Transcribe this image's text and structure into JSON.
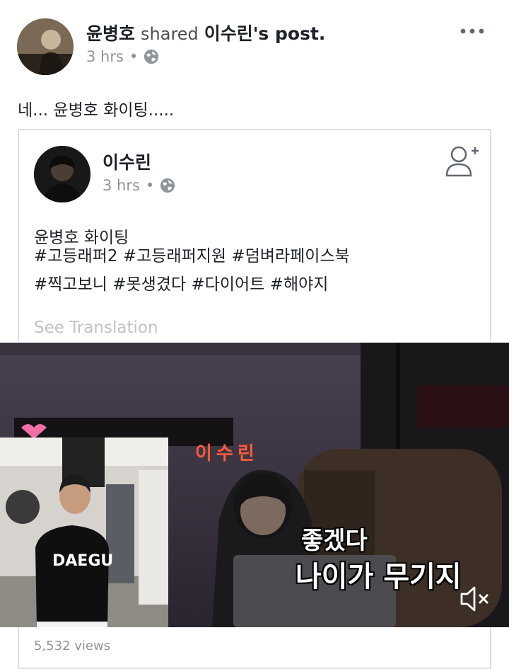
{
  "post": {
    "sharer_name": "윤병호",
    "shared_text": "shared",
    "original_owner": "이수린's post.",
    "time": "3 hrs",
    "privacy_icon": "globe-icon",
    "more_icon": "more-horizontal-icon",
    "message": "네... 윤병호 화이팅....."
  },
  "shared_post": {
    "author": "이수린",
    "time": "3 hrs",
    "privacy_icon": "globe-icon",
    "add_friend_icon": "add-friend-icon",
    "text_line1": "윤병호 화이팅",
    "hashtags_line1": "#고등래퍼2 #고등래퍼지원 #덤벼라페이스북",
    "hashtags_line2": "#찍고보니 #못생겼다 #다이어트 #해야지",
    "see_translation": "See Translation"
  },
  "video": {
    "sign_text": "이수린",
    "shirt_text": "DAEGU",
    "caption_line1": "좋겠다",
    "caption_line2": "나이가 무기지",
    "mute_icon": "speaker-muted-icon",
    "views": "5,532 views"
  },
  "colors": {
    "text": "#1d2129",
    "meta": "#90949c",
    "border": "#dddfe2",
    "translation": "#bec3c9"
  }
}
